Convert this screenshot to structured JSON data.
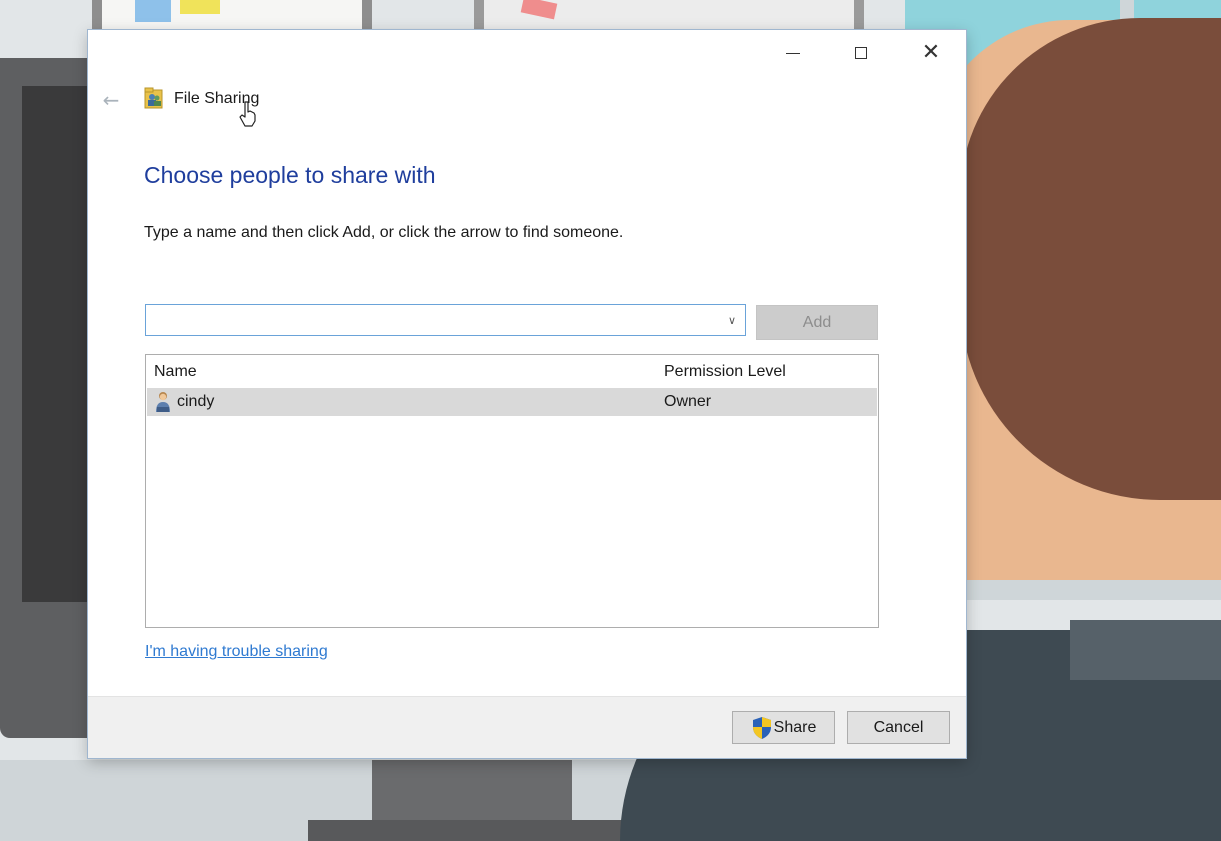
{
  "window": {
    "title": "File Sharing",
    "controls": {
      "minimize_icon": "minimize-icon",
      "maximize_icon": "maximize-icon",
      "close_icon": "close-icon"
    }
  },
  "nav": {
    "back_icon": "back-arrow-icon"
  },
  "content": {
    "heading": "Choose people to share with",
    "instructions": "Type a name and then click Add, or click the arrow to find someone.",
    "name_input": {
      "value": "",
      "placeholder": ""
    },
    "add_label": "Add",
    "table": {
      "columns": [
        "Name",
        "Permission Level"
      ],
      "rows": [
        {
          "name": "cindy",
          "permission": "Owner",
          "icon": "user-icon"
        }
      ]
    },
    "trouble_link": "I'm having trouble sharing"
  },
  "footer": {
    "share_label": "Share",
    "cancel_label": "Cancel"
  },
  "colors": {
    "heading": "#1f3e9d",
    "link": "#2f7ad1",
    "selected_row": "#d9d9d9",
    "input_border": "#6aa3d9"
  }
}
